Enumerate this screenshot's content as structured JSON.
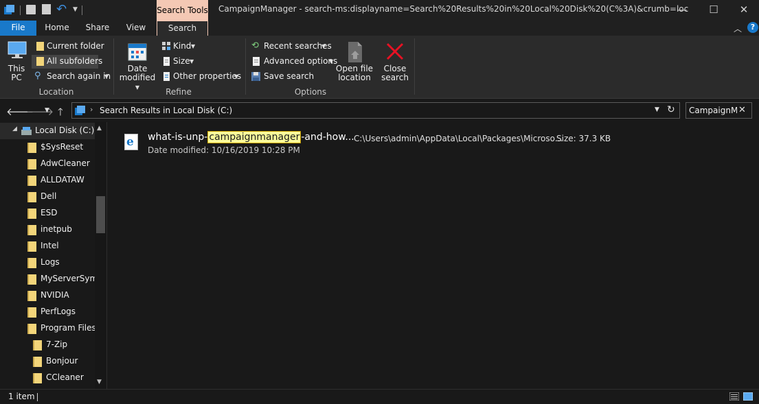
{
  "titlebar": {
    "context_tab": "Search Tools",
    "title": "CampaignManager - search-ms:displayname=Search%20Results%20in%20Local%20Disk%20(C%3A)&crumb=loc",
    "minimize": "—",
    "maximize": "☐",
    "close": "✕"
  },
  "tabs": {
    "file": "File",
    "home": "Home",
    "share": "Share",
    "view": "View",
    "search": "Search"
  },
  "ribbon": {
    "location": {
      "this_pc": [
        "This",
        "PC"
      ],
      "current_folder": "Current folder",
      "all_subfolders": "All subfolders",
      "search_again_in": "Search again in",
      "group_label": "Location"
    },
    "refine": {
      "date_modified": [
        "Date",
        "modified"
      ],
      "kind": "Kind",
      "size": "Size",
      "other_properties": "Other properties",
      "group_label": "Refine"
    },
    "options": {
      "recent_searches": "Recent searches",
      "advanced_options": "Advanced options",
      "save_search": "Save search",
      "open_file_location": [
        "Open file",
        "location"
      ],
      "close_search": [
        "Close",
        "search"
      ],
      "group_label": "Options"
    }
  },
  "address": {
    "path": "Search Results in Local Disk (C:)",
    "search_value": "CampaignManager"
  },
  "tree": {
    "root": "Local Disk (C:)",
    "items": [
      "$SysReset",
      "AdwCleaner",
      "ALLDATAW",
      "Dell",
      "ESD",
      "inetpub",
      "Intel",
      "Logs",
      "MyServerSymb",
      "NVIDIA",
      "PerfLogs",
      "Program Files"
    ],
    "children": [
      "7-Zip",
      "Bonjour",
      "CCleaner"
    ]
  },
  "result": {
    "name_prefix": "what-is-unp-",
    "name_highlight": "campaignmanager",
    "name_suffix": "-and-how...",
    "date_label": "Date modified:",
    "date_value": "10/16/2019 10:28 PM",
    "path": "C:\\Users\\admin\\AppData\\Local\\Packages\\Microso...",
    "size_label": "Size:",
    "size_value": "37.3 KB"
  },
  "status": {
    "count": "1 item"
  },
  "colors": {
    "accent": "#1979ca",
    "search_tools": "#f4c8b4",
    "highlight": "#fcfc9a",
    "close_red": "#e81123"
  }
}
